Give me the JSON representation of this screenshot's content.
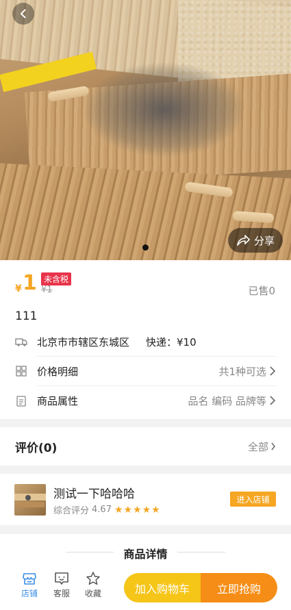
{
  "product": {
    "currency": "¥",
    "price": "1",
    "tax_badge": "未含税",
    "original_price": "¥1",
    "sold": "已售0",
    "title": "111"
  },
  "rows": {
    "shipping": {
      "location": "北京市市辖区东城区",
      "fee": "快递：¥10"
    },
    "price_detail": {
      "label": "价格明细",
      "value": "共1种可选"
    },
    "attributes": {
      "label": "商品属性",
      "value": "品名 编码 品牌等"
    }
  },
  "share_label": "分享",
  "review": {
    "title": "评价(0)",
    "all_label": "全部"
  },
  "store": {
    "name": "测试一下哈哈哈",
    "score_label": "综合评分",
    "score": "4.67",
    "rating": 4.67,
    "enter_label": "进入店铺"
  },
  "detail": {
    "title": "商品详情"
  },
  "bottom": {
    "tabs": [
      {
        "label": "店铺",
        "icon": "store-icon"
      },
      {
        "label": "客服",
        "icon": "chat-icon"
      },
      {
        "label": "收藏",
        "icon": "star-icon"
      }
    ],
    "cart_label": "加入购物车",
    "buy_label": "立即抢购"
  },
  "colors": {
    "accent": "#f5a623",
    "tax_red": "#e8334a",
    "tab_active": "#3a8ee6",
    "cart": "#f5c518",
    "buy": "#f58d16"
  }
}
